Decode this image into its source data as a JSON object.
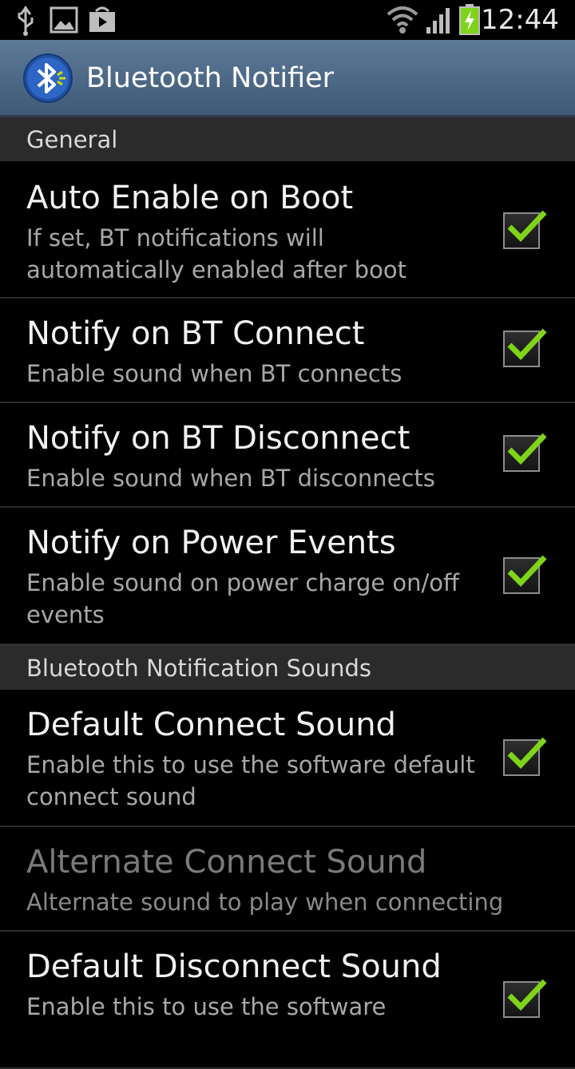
{
  "status_bar": {
    "time": "12:44",
    "icons": [
      "usb-icon",
      "image-icon",
      "play-store-icon",
      "wifi-icon",
      "signal-icon",
      "battery-charging-icon"
    ]
  },
  "action_bar": {
    "title": "Bluetooth Notifier",
    "icon": "bluetooth-speaker-icon"
  },
  "sections": [
    {
      "header": "General",
      "items": [
        {
          "title": "Auto Enable on Boot",
          "summary": "If set, BT notifications will automatically enabled after boot",
          "checked": true,
          "enabled": true
        },
        {
          "title": "Notify on BT Connect",
          "summary": "Enable sound when BT connects",
          "checked": true,
          "enabled": true
        },
        {
          "title": "Notify on BT Disconnect",
          "summary": "Enable sound when BT disconnects",
          "checked": true,
          "enabled": true
        },
        {
          "title": "Notify on Power Events",
          "summary": "Enable sound on power charge on/off events",
          "checked": true,
          "enabled": true
        }
      ]
    },
    {
      "header": "Bluetooth Notification Sounds",
      "items": [
        {
          "title": "Default Connect Sound",
          "summary": "Enable this to use the software default connect sound",
          "checked": true,
          "enabled": true
        },
        {
          "title": "Alternate Connect Sound",
          "summary": "Alternate sound to play when connecting",
          "checked": false,
          "enabled": false
        },
        {
          "title": "Default Disconnect Sound",
          "summary": "Enable this to use the software",
          "checked": true,
          "enabled": true
        }
      ]
    }
  ],
  "colors": {
    "accent_check": "#7fd41a",
    "action_bar": "#4a6785",
    "category_bg": "#2b2b2b"
  }
}
